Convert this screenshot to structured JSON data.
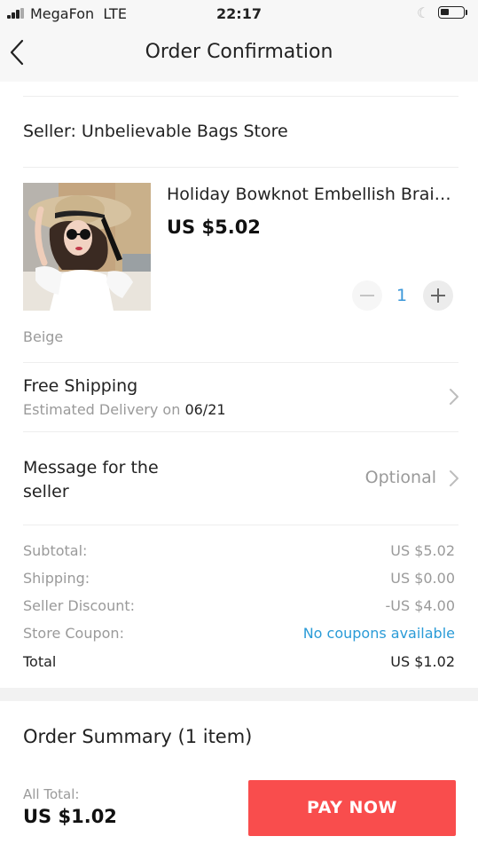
{
  "status_bar": {
    "carrier": "MegaFon",
    "network": "LTE",
    "time": "22:17",
    "signal_icon": "signal-bars-icon",
    "moon_icon": "moon-icon",
    "battery_icon": "battery-icon",
    "battery_level": 0.35
  },
  "nav": {
    "back_icon": "chevron-left-icon",
    "title": "Order Confirmation"
  },
  "seller": {
    "text": "Seller:  Unbelievable Bags Store"
  },
  "product": {
    "title": "Holiday Bowknot Embellish Braid...",
    "price": "US $5.02",
    "quantity": "1",
    "variant": "Beige",
    "minus_icon": "minus-icon",
    "plus_icon": "plus-icon",
    "image": "product-photo"
  },
  "shipping": {
    "title": "Free Shipping",
    "estimate_prefix": "Estimated Delivery on",
    "estimate_date": "06/21",
    "chevron_icon": "chevron-right-icon"
  },
  "message": {
    "label": "Message for the seller",
    "placeholder": "Optional",
    "chevron_icon": "chevron-right-icon"
  },
  "price_rows": {
    "subtotal": {
      "label": "Subtotal:",
      "value": "US $5.02"
    },
    "shipping": {
      "label": "Shipping:",
      "value": "US $0.00"
    },
    "seller_discount": {
      "label": "Seller Discount:",
      "value": "-US $4.00"
    },
    "store_coupon": {
      "label": "Store Coupon:",
      "value": "No coupons available"
    },
    "total": {
      "label": "Total",
      "value": "US $1.02"
    }
  },
  "summary": {
    "title": "Order Summary (1 item)",
    "all_total_label": "All Total:",
    "all_total_value": "US $1.02",
    "pay_button": "PAY NOW"
  },
  "colors": {
    "accent_red": "#f94d4d",
    "link_blue": "#2a9bd7",
    "quantity_blue": "#3a97d9",
    "muted_gray": "#9a9a9a"
  }
}
